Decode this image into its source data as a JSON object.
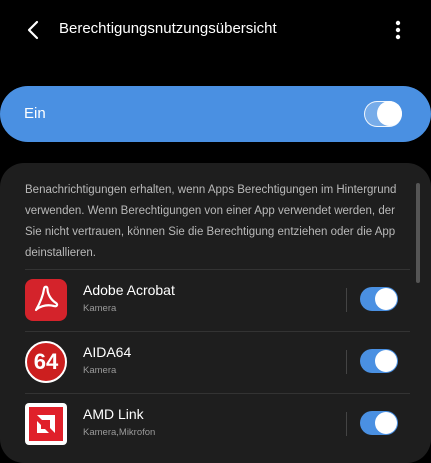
{
  "header": {
    "title": "Berechtigungsnutzungsübersicht",
    "back_icon": "arrow-left-icon",
    "more_icon": "more-vertical-icon"
  },
  "master_toggle": {
    "label": "Ein",
    "state": true,
    "accent": "#4a90e2"
  },
  "description": "Benachrichtigungen erhalten, wenn Apps Berechtigungen im Hintergrund verwenden. Wenn Berechtigungen von einer App verwendet werden, der Sie nicht vertrauen, können Sie die Berechtigung entziehen oder die App deinstallieren.",
  "apps": [
    {
      "name": "Adobe Acrobat",
      "permissions": "Kamera",
      "enabled": true,
      "icon": "adobe-acrobat-icon",
      "icon_color": "#d4232b"
    },
    {
      "name": "AIDA64",
      "permissions": "Kamera",
      "enabled": true,
      "icon": "aida64-icon",
      "icon_color": "#cc1f1f",
      "icon_text": "64"
    },
    {
      "name": "AMD Link",
      "permissions": "Kamera,Mikrofon",
      "enabled": true,
      "icon": "amd-link-icon",
      "icon_color": "#e0202a"
    }
  ]
}
